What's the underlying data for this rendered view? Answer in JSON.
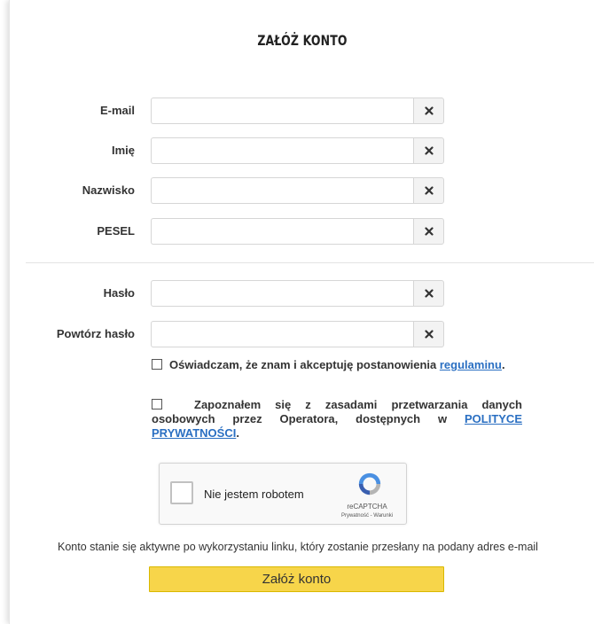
{
  "form": {
    "title": "ZAŁÓŻ KONTO",
    "fields": [
      {
        "label": "E-mail",
        "value": ""
      },
      {
        "label": "Imię",
        "value": ""
      },
      {
        "label": "Nazwisko",
        "value": ""
      },
      {
        "label": "PESEL",
        "value": ""
      },
      {
        "label": "Hasło",
        "value": ""
      },
      {
        "label": "Powtórz hasło",
        "value": ""
      }
    ],
    "clear_icon": "close-icon"
  },
  "consents": {
    "terms_text": "Oświadczam, że znam i akceptuję postanowienia ",
    "terms_link": "regulaminu",
    "terms_suffix": ".",
    "privacy_text": "Zapoznałem się z zasadami przetwarzania danych osobowych przez Operatora, dostępnych w ",
    "privacy_link": "POLITYCE PRYWATNOŚCI",
    "privacy_suffix": "."
  },
  "captcha": {
    "label": "Nie jestem robotem",
    "brand": "reCAPTCHA",
    "links": "Prywatność - Warunki",
    "icon": "recaptcha-logo-icon"
  },
  "info_text": "Konto stanie się aktywne po wykorzystaniu linku, który zostanie przesłany na podany adres e-mail",
  "submit_label": "Załóż konto",
  "colors": {
    "accent": "#f7d54a",
    "link": "#2a6fc2"
  }
}
